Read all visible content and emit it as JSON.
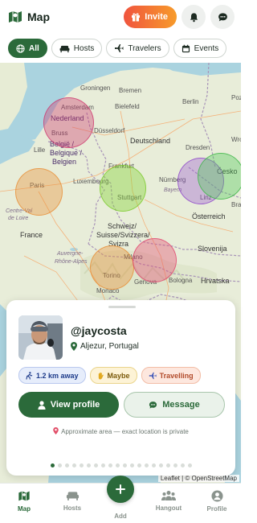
{
  "header": {
    "title": "Map",
    "invite_label": "Invite"
  },
  "filters": [
    {
      "label": "All",
      "icon": "globe-icon",
      "active": true
    },
    {
      "label": "Hosts",
      "icon": "sofa-icon",
      "active": false
    },
    {
      "label": "Travelers",
      "icon": "plane-icon",
      "active": false
    },
    {
      "label": "Events",
      "icon": "calendar-icon",
      "active": false
    }
  ],
  "map": {
    "labels": {
      "groningen": "Groningen",
      "bremen": "Bremen",
      "nederland": "Nederland",
      "amsterdam": "Amsterdam",
      "berlin": "Berlin",
      "bielefeld": "Bielefeld",
      "poznan": "Pozn",
      "brussels": "Bruss",
      "belgie": "België /",
      "belgique": "Belgique /",
      "belgien": "Belgien",
      "dusseldorf": "Düsseldorf",
      "deutschland": "Deutschland",
      "lille": "Lille",
      "dresden": "Dresden",
      "wroc": "Wroc",
      "luxembourg": "Luxembourg",
      "frankfurt": "Frankfurt",
      "cesko": "Česko",
      "paris": "Paris",
      "nurnberg": "Nürnberg",
      "stuttgart": "Stuttgart",
      "bayern": "Bayern",
      "centre": "Centre-Val",
      "deloire": "de Loire",
      "linz": "Linz",
      "bratis": "Bratis",
      "osterreich": "Österreich",
      "france": "France",
      "schweiz": "Schweiz/",
      "suisse": "Suisse/Svizzera/",
      "svizra": "Svizra",
      "slovenija": "Slovenija",
      "auvergne": "Auvergne-",
      "rhone": "Rhône-Alpes",
      "milano": "Milano",
      "hrvatska": "Hrvatska",
      "torino": "Torino",
      "genova": "Genova",
      "bologna": "Bologna",
      "monaco": "Monaco"
    },
    "attribution": "Leaflet | © OpenStreetMap"
  },
  "profile_card": {
    "username": "@jaycosta",
    "location": "Aljezur, Portugal",
    "badges": {
      "distance": "1.2 km away",
      "status": "Maybe",
      "mode": "Travelling"
    },
    "view_profile_label": "View profile",
    "message_label": "Message",
    "privacy_note": "Approximate area — exact location is private",
    "carousel_total": 20,
    "carousel_active": 1
  },
  "bottom_nav": {
    "map": "Map",
    "hosts": "Hosts",
    "add": "Add",
    "hangout": "Hangout",
    "profile": "Profile"
  },
  "colors": {
    "primary": "#2b6a3a",
    "invite_gradient_start": "#f0543e",
    "invite_gradient_end": "#f79b2a"
  }
}
